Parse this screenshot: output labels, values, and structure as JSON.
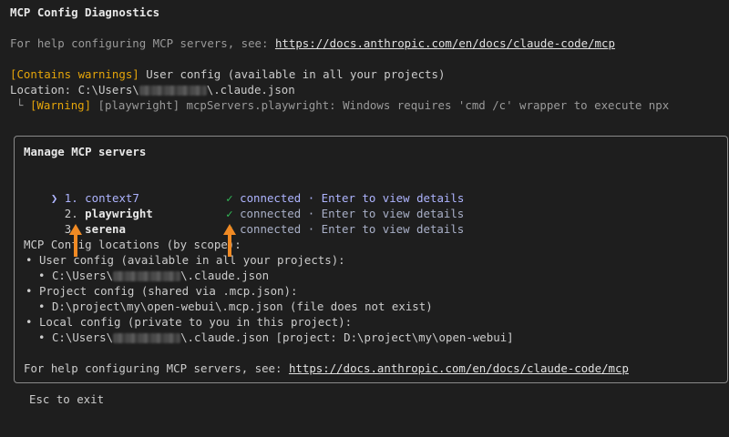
{
  "header": {
    "title": "MCP Config Diagnostics",
    "help_prefix": "For help configuring MCP servers, see: ",
    "help_url": "https://docs.anthropic.com/en/docs/claude-code/mcp"
  },
  "user_config": {
    "badge": "[Contains warnings]",
    "label": " User config (available in all your projects)",
    "location_prefix": "Location: C:\\Users\\",
    "location_suffix": "\\.claude.json",
    "tree_glyph": "└",
    "warning_badge": "[Warning]",
    "warning_text": " [playwright] mcpServers.playwright: Windows requires 'cmd /c' wrapper to execute npx"
  },
  "panel": {
    "title": "Manage MCP servers",
    "pointer": "❯",
    "servers": [
      {
        "index": "1.",
        "name": "context7",
        "check": "✓",
        "status": "connected · Enter to view details",
        "selected": true
      },
      {
        "index": "2.",
        "name": "playwright",
        "check": "✓",
        "status": "connected · Enter to view details",
        "selected": false
      },
      {
        "index": "3.",
        "name": "serena",
        "check": "✓",
        "status": "connected · Enter to view details",
        "selected": false
      }
    ],
    "locations_title": "MCP Config locations (by scope):",
    "bullet": "•",
    "scopes": [
      {
        "label": "User config (available in all your projects):",
        "path_prefix": "C:\\Users\\",
        "path_suffix": "\\.claude.json"
      },
      {
        "label": "Project config (shared via .mcp.json):",
        "path_prefix": "D:\\project\\my\\open-webui\\.mcp.json (file does not exist)",
        "path_suffix": ""
      },
      {
        "label": "Local config (private to you in this project):",
        "path_prefix": "C:\\Users\\",
        "path_suffix": "\\.claude.json [project: D:\\project\\my\\open-webui]"
      }
    ],
    "help_prefix": "For help configuring MCP servers, see: ",
    "help_url": "https://docs.anthropic.com/en/docs/claude-code/mcp"
  },
  "footer": {
    "hint": "Esc to exit"
  },
  "colors": {
    "warning": "#e5a50a",
    "check": "#33c25a",
    "selected": "#aeb4ff",
    "annotation_arrow": "#f08a24"
  }
}
